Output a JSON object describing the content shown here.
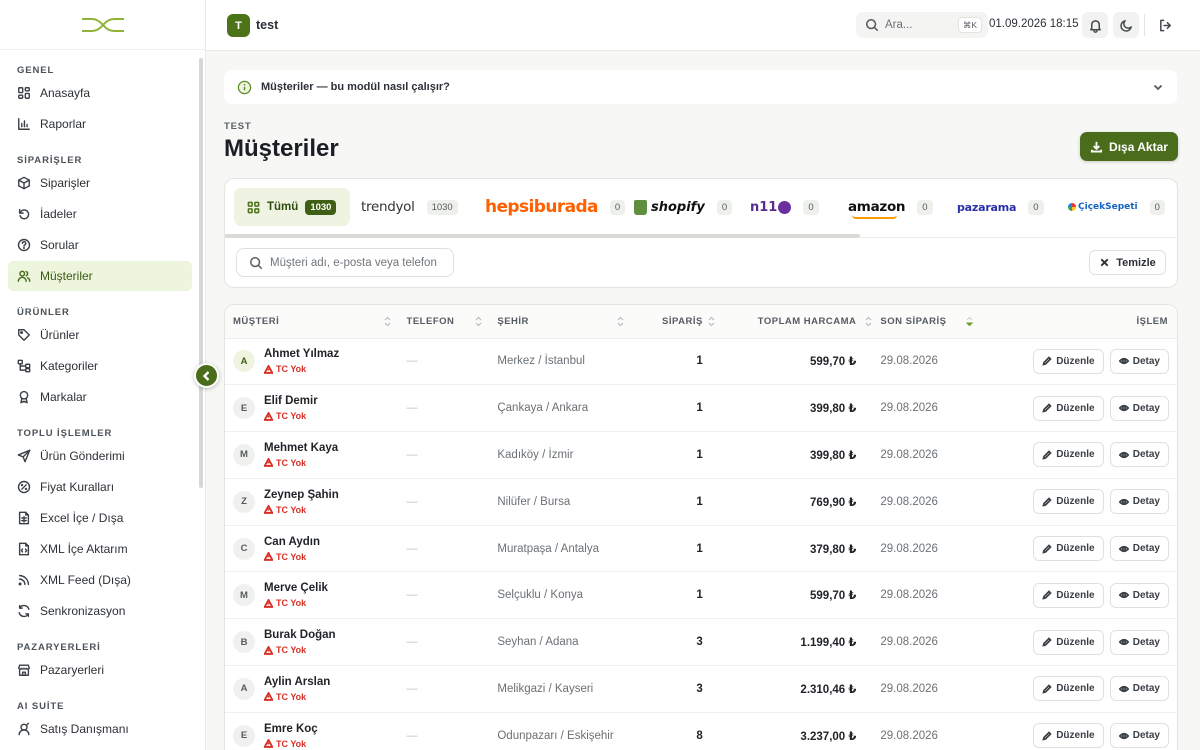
{
  "header": {
    "workspace_initial": "T",
    "workspace_name": "test",
    "search_placeholder": "Ara...",
    "search_shortcut": "⌘K",
    "datetime": "01.09.2026 18:15"
  },
  "sidebar": {
    "sections": [
      {
        "title": "GENEL",
        "items": [
          {
            "label": "Anasayfa",
            "icon": "dashboard-icon"
          },
          {
            "label": "Raporlar",
            "icon": "bar-chart-icon"
          }
        ]
      },
      {
        "title": "SİPARİŞLER",
        "items": [
          {
            "label": "Siparişler",
            "icon": "package-icon"
          },
          {
            "label": "İadeler",
            "icon": "undo-icon"
          },
          {
            "label": "Sorular",
            "icon": "help-circle-icon"
          },
          {
            "label": "Müşteriler",
            "icon": "users-icon",
            "active": true
          }
        ]
      },
      {
        "title": "ÜRÜNLER",
        "items": [
          {
            "label": "Ürünler",
            "icon": "tag-icon"
          },
          {
            "label": "Kategoriler",
            "icon": "tree-icon"
          },
          {
            "label": "Markalar",
            "icon": "award-icon"
          }
        ]
      },
      {
        "title": "TOPLU İŞLEMLER",
        "items": [
          {
            "label": "Ürün Gönderimi",
            "icon": "send-icon"
          },
          {
            "label": "Fiyat Kuralları",
            "icon": "percent-icon"
          },
          {
            "label": "Excel İçe / Dışa",
            "icon": "spreadsheet-icon"
          },
          {
            "label": "XML İçe Aktarım",
            "icon": "code-file-icon"
          },
          {
            "label": "XML Feed (Dışa)",
            "icon": "rss-icon"
          },
          {
            "label": "Senkronizasyon",
            "icon": "refresh-icon"
          }
        ]
      },
      {
        "title": "PAZARYERLERİ",
        "items": [
          {
            "label": "Pazaryerleri",
            "icon": "store-icon"
          }
        ]
      },
      {
        "title": "AI SUİTE",
        "items": [
          {
            "label": "Satış Danışmanı",
            "icon": "assistant-icon"
          }
        ]
      }
    ]
  },
  "main": {
    "info_title": "Müşteriler — bu modül nasıl çalışır?",
    "eyebrow": "TEST",
    "title": "Müşteriler",
    "export_label": "Dışa Aktar",
    "search_placeholder": "Müşteri adı, e-posta veya telefon",
    "clear_label": "Temizle",
    "tabs": [
      {
        "key": "all",
        "label": "Tümü",
        "count": "1030"
      },
      {
        "key": "trendyol",
        "brand": "trendyol",
        "count": "1030"
      },
      {
        "key": "hepsiburada",
        "brand": "hepsiburada",
        "count": "0"
      },
      {
        "key": "shopify",
        "brand": "shopify",
        "count": "0"
      },
      {
        "key": "n11",
        "brand": "n11",
        "count": "0"
      },
      {
        "key": "amazon",
        "brand": "amazon",
        "count": "0"
      },
      {
        "key": "pazarama",
        "brand": "pazarama",
        "count": "0"
      },
      {
        "key": "ciceksepeti",
        "brand": "ÇiçekSepeti",
        "count": "0"
      }
    ],
    "table": {
      "columns": [
        "MÜŞTERİ",
        "TELEFON",
        "ŞEHİR",
        "SİPARİŞ",
        "TOPLAM HARCAMA",
        "SON SİPARİŞ",
        "İŞLEM"
      ],
      "edit_label": "Düzenle",
      "detail_label": "Detay",
      "tc_label": "TC Yok",
      "empty_value": "—",
      "rows": [
        {
          "initial": "A",
          "name": "Ahmet Yılmaz",
          "city": "Merkez / İstanbul",
          "orders": "1",
          "total": "599,70 ₺",
          "last": "29.08.2026"
        },
        {
          "initial": "E",
          "name": "Elif Demir",
          "city": "Çankaya / Ankara",
          "orders": "1",
          "total": "399,80 ₺",
          "last": "29.08.2026"
        },
        {
          "initial": "M",
          "name": "Mehmet Kaya",
          "city": "Kadıköy / İzmir",
          "orders": "1",
          "total": "399,80 ₺",
          "last": "29.08.2026"
        },
        {
          "initial": "Z",
          "name": "Zeynep Şahin",
          "city": "Nilüfer / Bursa",
          "orders": "1",
          "total": "769,90 ₺",
          "last": "29.08.2026"
        },
        {
          "initial": "C",
          "name": "Can Aydın",
          "city": "Muratpaşa / Antalya",
          "orders": "1",
          "total": "379,80 ₺",
          "last": "29.08.2026"
        },
        {
          "initial": "M",
          "name": "Merve Çelik",
          "city": "Selçuklu / Konya",
          "orders": "1",
          "total": "599,70 ₺",
          "last": "29.08.2026"
        },
        {
          "initial": "B",
          "name": "Burak Doğan",
          "city": "Seyhan / Adana",
          "orders": "3",
          "total": "1.199,40 ₺",
          "last": "29.08.2026"
        },
        {
          "initial": "A",
          "name": "Aylin Arslan",
          "city": "Melikgazi / Kayseri",
          "orders": "3",
          "total": "2.310,46 ₺",
          "last": "29.08.2026"
        },
        {
          "initial": "E",
          "name": "Emre Koç",
          "city": "Odunpazarı / Eskişehir",
          "orders": "8",
          "total": "3.237,00 ₺",
          "last": "29.08.2026"
        }
      ]
    }
  },
  "colors": {
    "brand_green": "#4a6d1c",
    "active_bg": "#edf5dc",
    "warning_red": "#d93025"
  }
}
